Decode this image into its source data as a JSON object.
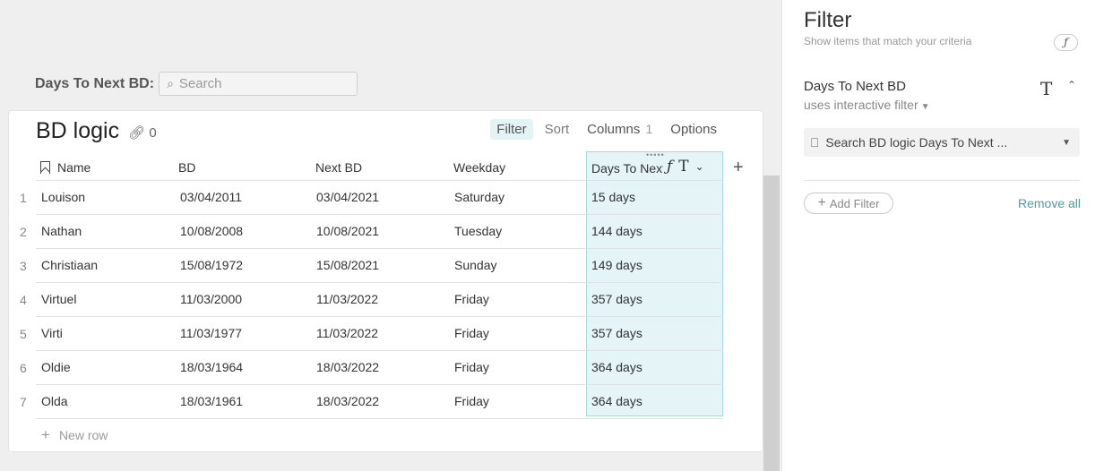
{
  "canvas": {
    "search": {
      "label": "Days To Next BD:",
      "placeholder": "Search"
    }
  },
  "table": {
    "title": "BD logic",
    "link_count": "0",
    "toolbar": {
      "filter": "Filter",
      "sort": "Sort",
      "columns": "Columns",
      "columns_count": "1",
      "options": "Options"
    },
    "columns": [
      "Name",
      "BD",
      "Next BD",
      "Weekday",
      "Days To Next BD"
    ],
    "selected_column_icons": {
      "formula": "ƒ",
      "type": "T",
      "menu": "⌄"
    },
    "rows": [
      {
        "n": "1",
        "name": "Louison",
        "bd": "03/04/2011",
        "next_bd": "03/04/2021",
        "weekday": "Saturday",
        "days": "15 days"
      },
      {
        "n": "2",
        "name": "Nathan",
        "bd": "10/08/2008",
        "next_bd": "10/08/2021",
        "weekday": "Tuesday",
        "days": "144 days"
      },
      {
        "n": "3",
        "name": "Christiaan",
        "bd": "15/08/1972",
        "next_bd": "15/08/2021",
        "weekday": "Sunday",
        "days": "149 days"
      },
      {
        "n": "4",
        "name": "Virtuel",
        "bd": "11/03/2000",
        "next_bd": "11/03/2022",
        "weekday": "Friday",
        "days": "357 days"
      },
      {
        "n": "5",
        "name": "Virti",
        "bd": "11/03/1977",
        "next_bd": "11/03/2022",
        "weekday": "Friday",
        "days": "357 days"
      },
      {
        "n": "6",
        "name": "Oldie",
        "bd": "18/03/1964",
        "next_bd": "18/03/2022",
        "weekday": "Friday",
        "days": "364 days"
      },
      {
        "n": "7",
        "name": "Olda",
        "bd": "18/03/1961",
        "next_bd": "18/03/2022",
        "weekday": "Friday",
        "days": "364 days"
      }
    ],
    "new_row": "New row"
  },
  "panel": {
    "title": "Filter",
    "subtitle": "Show items that match your criteria",
    "formula_icon": "ƒ",
    "filter": {
      "column": "Days To Next BD",
      "mode": "uses interactive filter",
      "type_icon": "T",
      "search_text": "Search BD logic Days To Next ..."
    },
    "add_filter": "Add Filter",
    "remove_all": "Remove all"
  },
  "colors": {
    "accent": "#4e9ba3",
    "selected_fill": "#e4f4f7",
    "selected_border": "#a7d8df"
  }
}
